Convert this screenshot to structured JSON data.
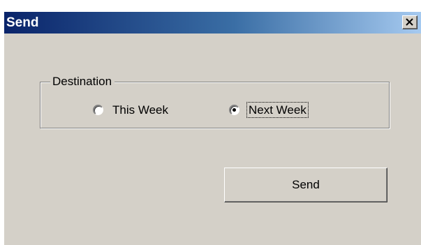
{
  "window": {
    "title": "Send",
    "close_icon": "close-icon"
  },
  "destination_group": {
    "label": "Destination",
    "options": [
      {
        "label": "This Week",
        "selected": false
      },
      {
        "label": "Next Week",
        "selected": true
      }
    ]
  },
  "actions": {
    "send_label": "Send"
  },
  "colors": {
    "titlebar_start": "#0a246a",
    "titlebar_end": "#a6caf0",
    "dialog_face": "#d4d0c8"
  }
}
